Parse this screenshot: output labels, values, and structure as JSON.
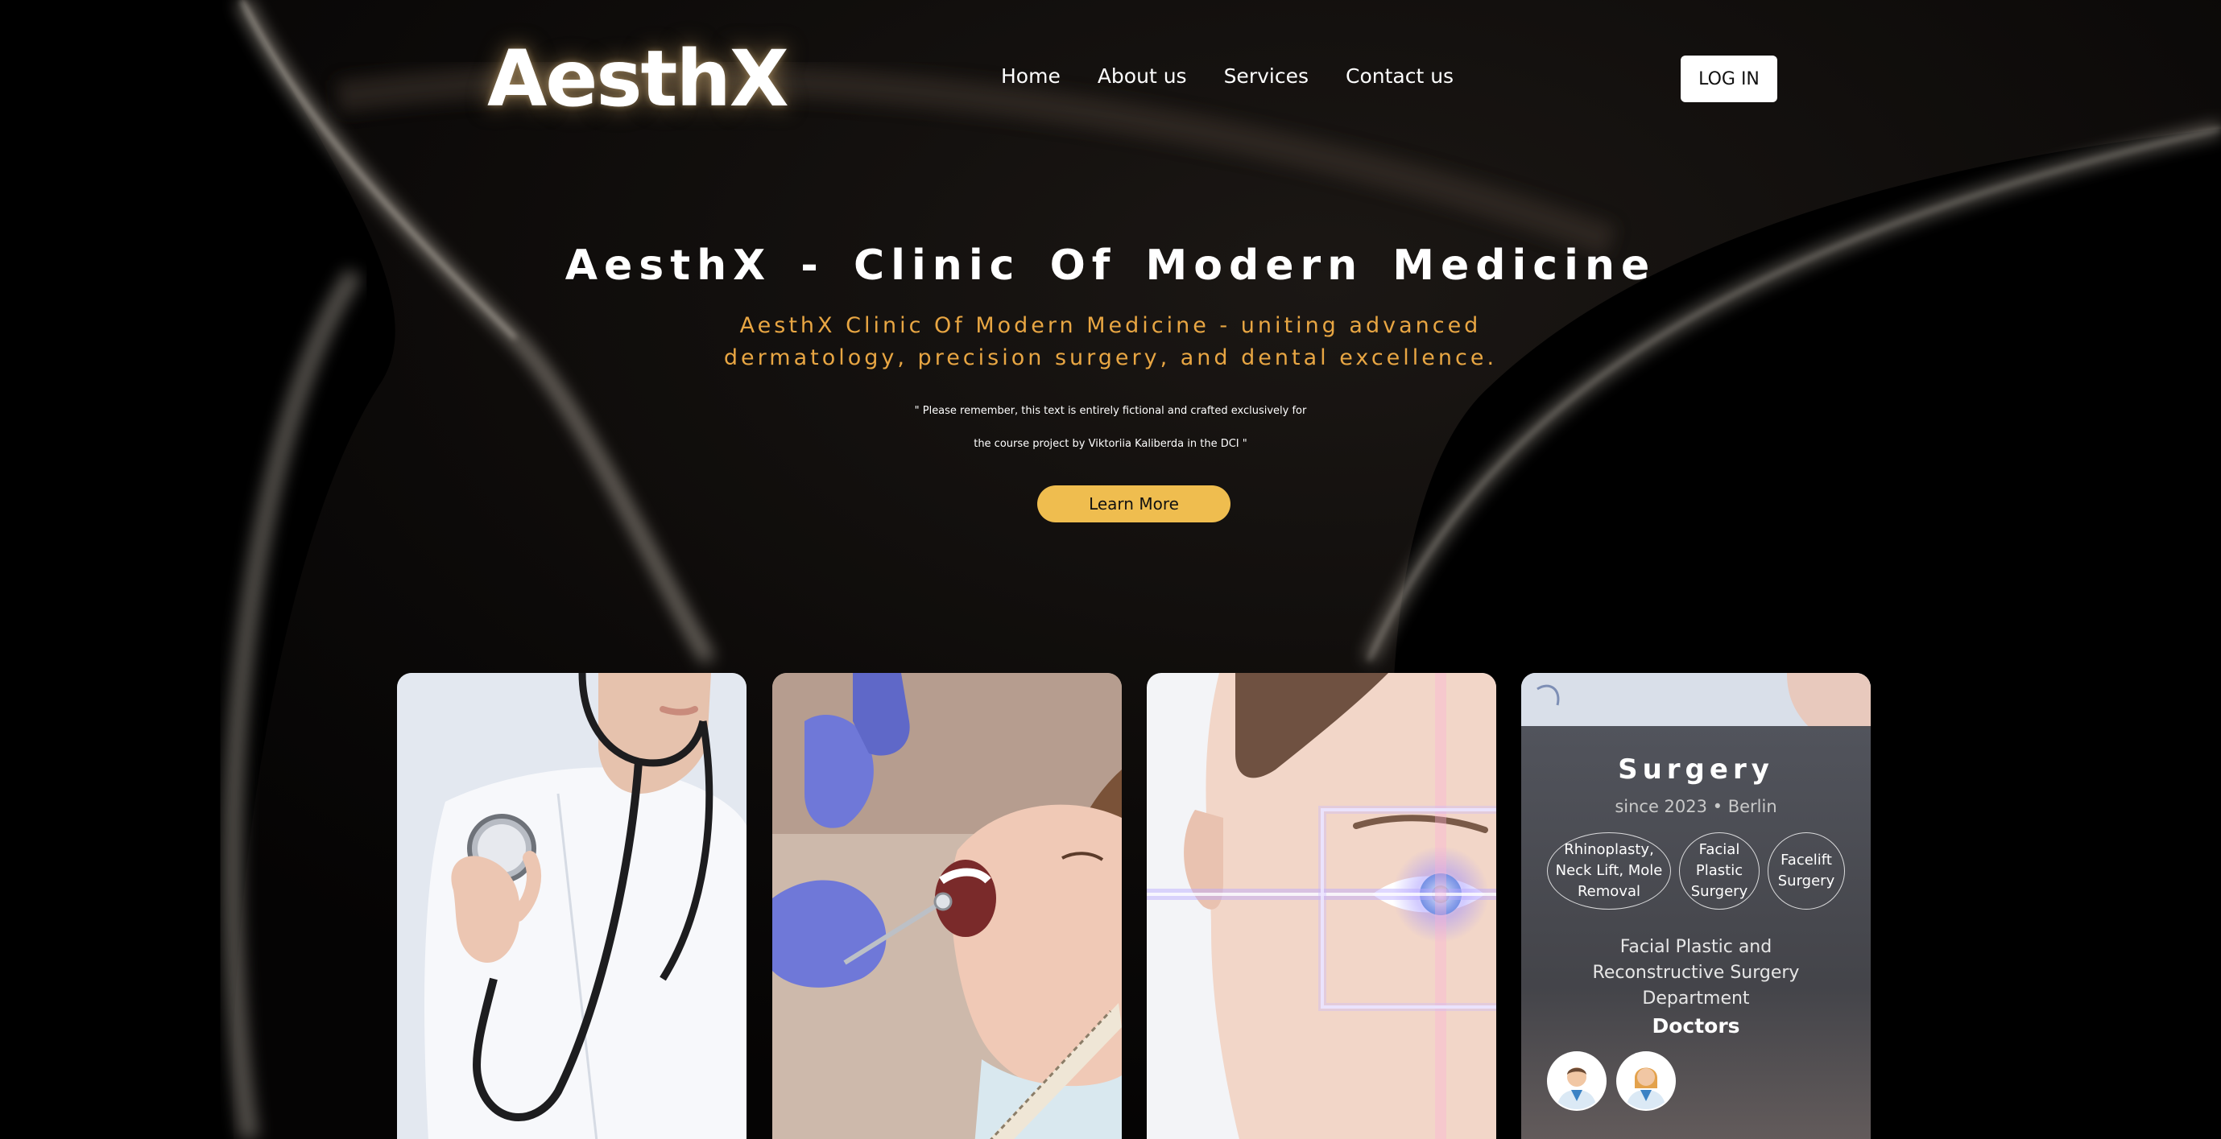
{
  "header": {
    "logo": "AesthX",
    "nav": [
      "Home",
      "About us",
      "Services",
      "Contact us"
    ],
    "login_label": "LOG IN"
  },
  "hero": {
    "title": "AesthX - Clinic Of Modern Medicine",
    "subtitle": "AesthX Clinic Of Modern Medicine - uniting advanced dermatology, precision surgery, and dental excellence.",
    "note": "\" Please remember, this text is entirely fictional and crafted exclusively for the course project by Viktoriia Kaliberda in the DCI \"",
    "cta_label": "Learn More"
  },
  "cards": [
    {
      "image": "doctor-with-stethoscope"
    },
    {
      "image": "dental-examination"
    },
    {
      "image": "laser-eye-scan"
    },
    {
      "title": "Surgery",
      "since": "since 2023 • Berlin",
      "tags": [
        "Rhinoplasty, Neck Lift, Mole Removal",
        "Facial Plastic Surgery",
        "Facelift Surgery"
      ],
      "department": "Facial Plastic and Reconstructive Surgery Department",
      "doctors_title": "Doctors",
      "doctors": [
        "male-doctor-avatar",
        "female-doctor-avatar"
      ]
    }
  ],
  "colors": {
    "accent": "#e8a643",
    "button": "#efbd4f",
    "background": "#000000"
  }
}
